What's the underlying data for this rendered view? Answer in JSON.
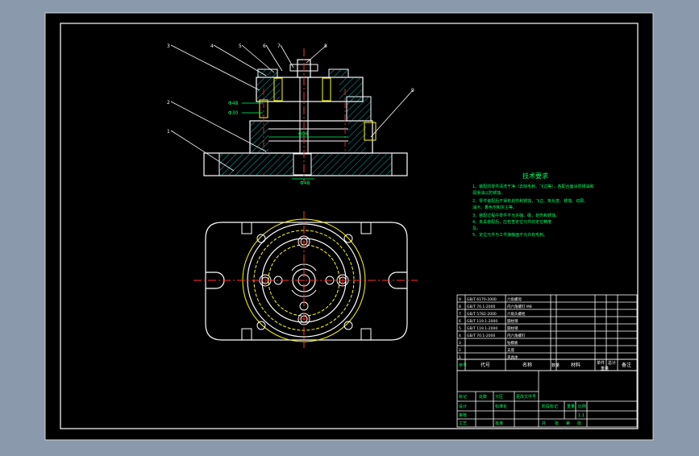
{
  "drawing": {
    "background_color": "#000000",
    "viewport_color": "#8a9aac",
    "line_colors": {
      "outline": "#ffffff",
      "centerline": "#ff3030",
      "hidden": "#ffff00",
      "dimension": "#00ff66",
      "hatch": "#00b0b0",
      "leader": "#ffffff"
    },
    "part_labels": [
      "3",
      "4",
      "5",
      "6",
      "7",
      "8",
      "2",
      "1",
      "9"
    ],
    "dimension_labels": {
      "dim_left_top": "Φ48",
      "dim_left_bottom": "Φ30",
      "dim_center": "Φ96",
      "dim_bottom": "Φ48"
    },
    "technical_requirements": {
      "title": "技术要求",
      "lines": [
        "1、装配前零件清洗干净（去除毛刺、飞边等），各配合面涂防锈油和",
        "   润滑油以防锈蚀。",
        "2、零件装配后不得有划伤和锈蚀，飞边、氧化皮、锈蚀、切屑、",
        "   油污、着色剂和灰尘等。",
        "3、装配过程中零件不允许磕、碰、划伤和锈蚀。",
        "4、夹具装配后，应检查定位元件的定位精度",
        "   及。",
        "5、定位元件与工件接触面不允许有毛刺。"
      ]
    },
    "parts_list": {
      "rows": [
        [
          "9",
          "GB/T 6170-2000",
          "六角螺母",
          "",
          "",
          "",
          "",
          ""
        ],
        [
          "8",
          "GB/T 70.1-2000",
          "内六角螺钉 M8",
          "",
          "",
          "",
          "",
          ""
        ],
        [
          "7",
          "GB/T 5782-2000",
          "六角头螺栓",
          "",
          "",
          "",
          "",
          ""
        ],
        [
          "6",
          "GB/T 119.1-2000",
          "圆柱销",
          "",
          "",
          "",
          "",
          ""
        ],
        [
          "5",
          "GB/T 119.1-2000",
          "圆柱销",
          "",
          "",
          "",
          "",
          ""
        ],
        [
          "4",
          "GB/T 70.1-2000",
          "内六角螺钉",
          "",
          "",
          "",
          "",
          ""
        ],
        [
          "3",
          "",
          "钻模板",
          "",
          "",
          "",
          "",
          ""
        ],
        [
          "2",
          "",
          "支座",
          "",
          "",
          "",
          "",
          ""
        ],
        [
          "1",
          "",
          "夹具体",
          "",
          "",
          "",
          "",
          ""
        ]
      ],
      "header": [
        "序号",
        "代号",
        "名称",
        "数量",
        "材料",
        "单件",
        "总计",
        "备注"
      ],
      "header_sub": "重量"
    },
    "title_block": {
      "scale": "1:1",
      "labels": [
        "标记",
        "处数",
        "分区",
        "更改文件号",
        "签名",
        "年、月、日",
        "设计",
        "标准化",
        "审核",
        "工艺",
        "批准",
        "阶段标记",
        "重量",
        "比例",
        "共",
        "张",
        "第",
        "张"
      ]
    }
  }
}
